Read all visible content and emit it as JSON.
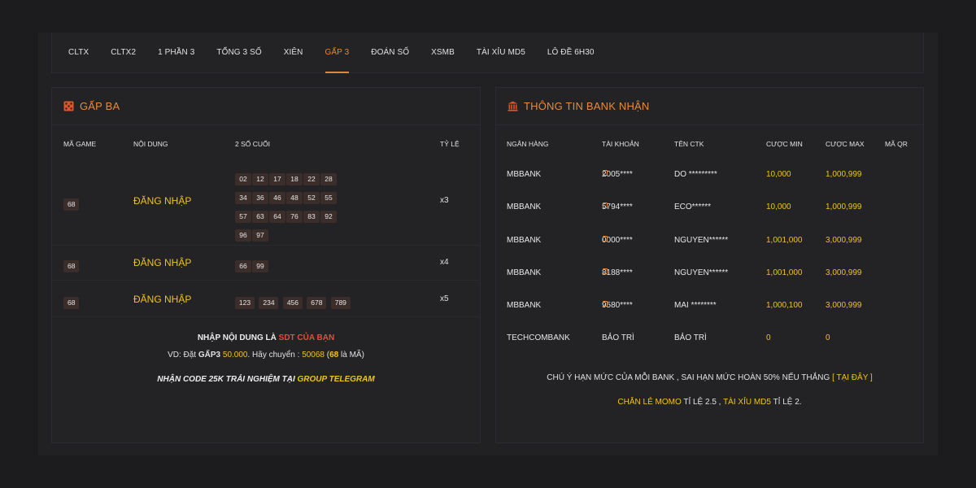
{
  "tabs": [
    {
      "label": "CLTX",
      "active": false
    },
    {
      "label": "CLTX2",
      "active": false
    },
    {
      "label": "1 PHẦN 3",
      "active": false
    },
    {
      "label": "TỔNG 3 SỐ",
      "active": false
    },
    {
      "label": "XIÊN",
      "active": false
    },
    {
      "label": "GẤP 3",
      "active": true
    },
    {
      "label": "ĐOÁN SỐ",
      "active": false
    },
    {
      "label": "XSMB",
      "active": false
    },
    {
      "label": "TÀI XỈU MD5",
      "active": false
    },
    {
      "label": "LÔ ĐỀ 6H30",
      "active": false
    }
  ],
  "left": {
    "title": "GẤP BA",
    "icon": "dice-icon",
    "headers": {
      "code": "MÃ GAME",
      "content": "NỘI DUNG",
      "last2": "2 SỐ CUỐI",
      "rate": "TỶ LỆ"
    },
    "rows": [
      {
        "code": "68",
        "content": "ĐĂNG NHẬP",
        "numbers": [
          "02",
          "12",
          "17",
          "18",
          "22",
          "28",
          "34",
          "36",
          "46",
          "48",
          "52",
          "55",
          "57",
          "63",
          "64",
          "76",
          "83",
          "92",
          "96",
          "97"
        ],
        "rate": "x3"
      },
      {
        "code": "68",
        "content": "ĐĂNG NHẬP",
        "numbers": [
          "66",
          "99"
        ],
        "rate": "x4"
      },
      {
        "code": "68",
        "content": "ĐĂNG NHẬP",
        "numbers": [
          "123",
          "234",
          "456",
          "678",
          "789"
        ],
        "rate": "x5"
      }
    ],
    "note": {
      "l1_a": "NHẬP NỘI DUNG LÀ ",
      "l1_b": "SDT CỦA BẠN",
      "l2_a": "VD: Đặt ",
      "l2_b": "GẤP3",
      "l2_c": " 50.000",
      "l2_d": ". Hãy chuyển : ",
      "l2_e": "50068",
      "l2_f": " (",
      "l2_g": "68",
      "l2_h": " là MÃ)",
      "l3_a": "NHẬN CODE 25K TRẢI NGHIỆM TẠI ",
      "l3_b": "GROUP TELEGRAM"
    }
  },
  "right": {
    "title": "THÔNG TIN BANK NHẬN",
    "icon": "bank-icon",
    "headers": {
      "bank": "NGÂN HÀNG",
      "account": "TÀI KHOẢN",
      "holder": "TÊN CTK",
      "min": "CƯỢC MIN",
      "max": "CƯỢC MAX",
      "qr": "MÃ QR"
    },
    "rows": [
      {
        "bank": "MBBANK",
        "account": "2005****",
        "holder": "DO *********",
        "min": "10,000",
        "max": "1,000,999",
        "copy": true
      },
      {
        "bank": "MBBANK",
        "account": "5794****",
        "holder": "ECO******",
        "min": "10,000",
        "max": "1,000,999",
        "copy": true
      },
      {
        "bank": "MBBANK",
        "account": "0000****",
        "holder": "NGUYEN******",
        "min": "1,001,000",
        "max": "3,000,999",
        "copy": true
      },
      {
        "bank": "MBBANK",
        "account": "8188****",
        "holder": "NGUYEN******",
        "min": "1,001,000",
        "max": "3,000,999",
        "copy": true
      },
      {
        "bank": "MBBANK",
        "account": "9580****",
        "holder": "MAI ********",
        "min": "1,000,100",
        "max": "3,000,999",
        "copy": true
      },
      {
        "bank": "TECHCOMBANK",
        "account": "BẢO TRÌ",
        "holder": "BẢO TRÌ",
        "min": "0",
        "max": "0",
        "copy": false
      }
    ],
    "note": {
      "l1_a": "CHÚ Ý HẠN MỨC CỦA MỖI BANK , SAI HẠN MỨC HOÀN 50% NẾU THẮNG ",
      "l1_b": "[ TẠI ĐÂY ]",
      "l2_a": "CHẴN LẺ MOMO",
      "l2_b": " TỈ LỆ 2.5 , ",
      "l2_c": "TÀI XỈU MD5",
      "l2_d": " TỈ LỆ 2."
    }
  }
}
